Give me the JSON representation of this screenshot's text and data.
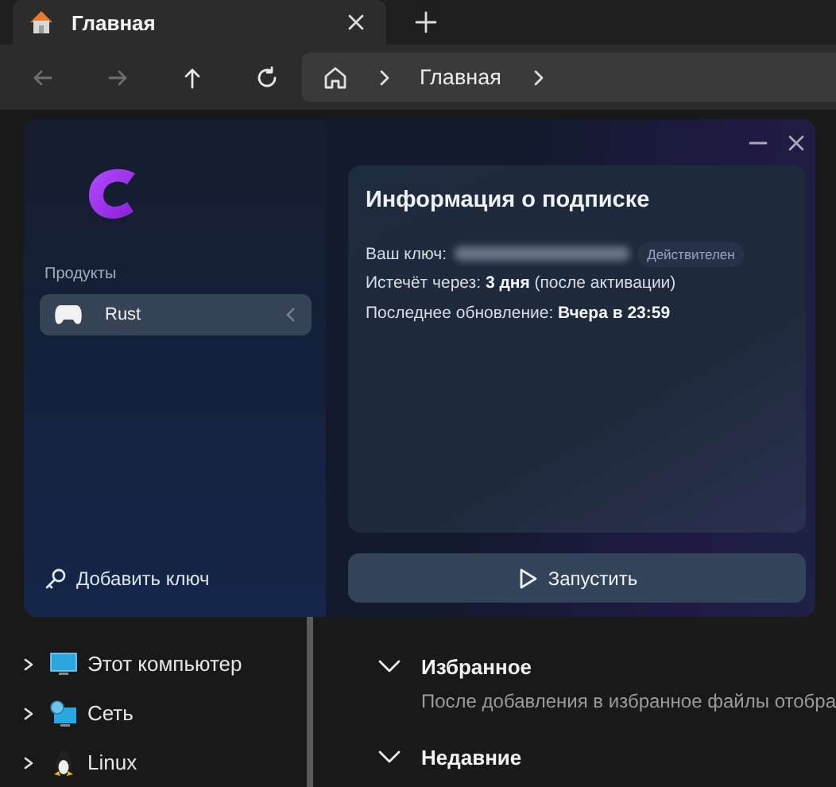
{
  "tab": {
    "title": "Главная",
    "selected": true
  },
  "nav_buttons": [
    {
      "kind": "back",
      "disabled": true
    },
    {
      "kind": "forward",
      "disabled": true
    },
    {
      "kind": "up",
      "disabled": false
    },
    {
      "kind": "refresh",
      "disabled": false
    }
  ],
  "breadcrumb": [
    {
      "label": "Главная"
    }
  ],
  "dialog": {
    "sidebar": {
      "section_label": "Продукты",
      "products": [
        {
          "name": "Rust",
          "selected": true
        }
      ],
      "add_key": "Добавить ключ"
    },
    "card": {
      "title": "Информация о подписке",
      "rows": [
        {
          "kind": "key",
          "label": "Ваш ключ:",
          "badge": "Действителен"
        },
        {
          "kind": "text",
          "text": "Истечёт через: **3 дня** (после активации)"
        },
        {
          "kind": "text",
          "text": "Последнее обновление: **Вчера в 23:59**"
        }
      ]
    },
    "launch_button": "Запустить"
  },
  "nav_tree": [
    {
      "label": "Этот компьютер",
      "kind": "computer",
      "expanded": false
    },
    {
      "label": "Сеть",
      "kind": "network",
      "expanded": false
    },
    {
      "label": "Linux",
      "kind": "linux",
      "expanded": false
    }
  ],
  "sections": [
    {
      "title": "Избранное",
      "expanded": true,
      "description": "После добавления в избранное файлы отобра"
    },
    {
      "title": "Недавние",
      "expanded": true
    }
  ]
}
